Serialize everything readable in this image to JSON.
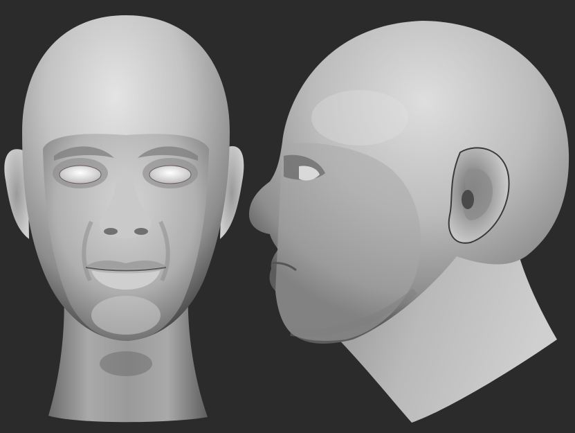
{
  "scene": {
    "background_color": "#2b2b2b",
    "material_color": "#c9c9c9",
    "shadow_color": "#5a5a5a",
    "views": [
      {
        "id": "front",
        "label_icon": "front-head-view"
      },
      {
        "id": "side",
        "label_icon": "side-head-view"
      }
    ]
  }
}
